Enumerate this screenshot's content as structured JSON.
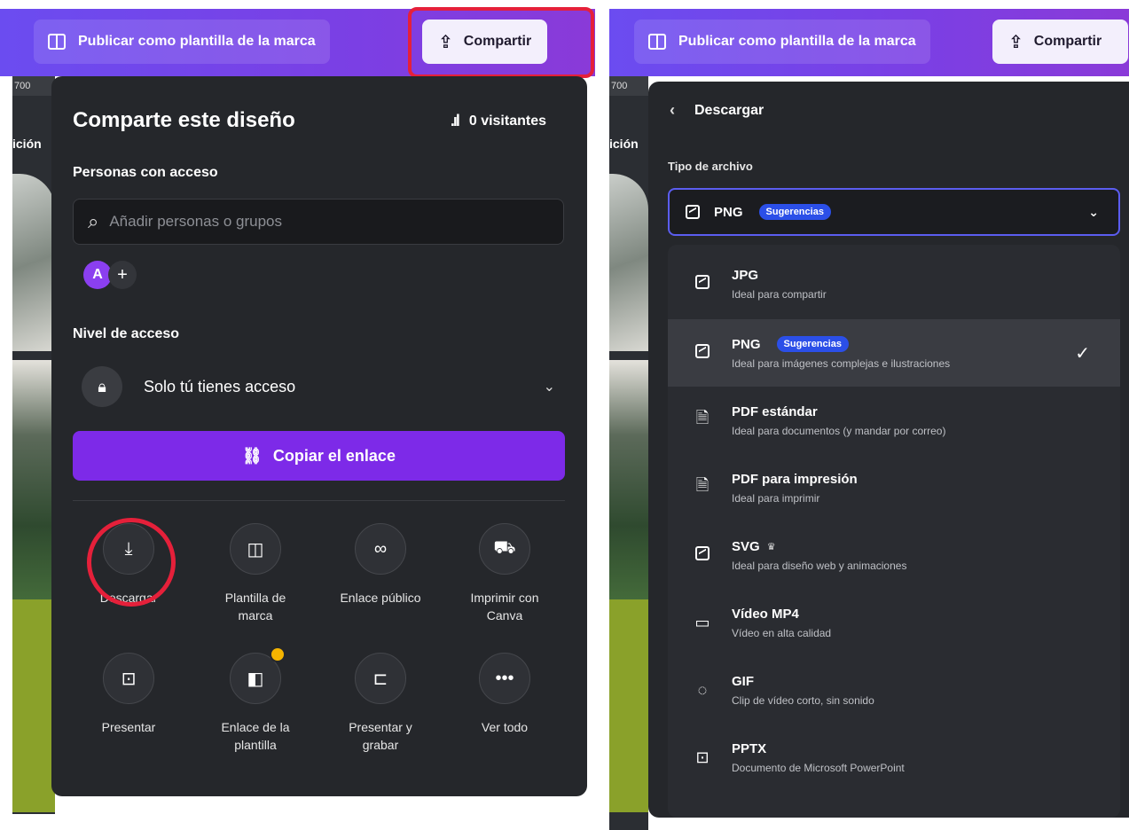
{
  "left": {
    "topbar": {
      "publish_label": "Publicar como plantilla de la marca",
      "share_label": "Compartir"
    },
    "canvas": {
      "ruler": "700",
      "label": "ición"
    },
    "share": {
      "title": "Comparte este diseño",
      "visitors": "0 visitantes",
      "people_label": "Personas con acceso",
      "search_placeholder": "Añadir personas o grupos",
      "avatar_initial": "A",
      "access_label": "Nivel de acceso",
      "access_value": "Solo tú tienes acceso",
      "copy_label": "Copiar el enlace",
      "actions": [
        {
          "label": "Descargar",
          "icon": "download-icon"
        },
        {
          "label": "Plantilla de marca",
          "icon": "brand-template-icon"
        },
        {
          "label": "Enlace público",
          "icon": "link-icon"
        },
        {
          "label": "Imprimir con Canva",
          "icon": "truck-icon"
        },
        {
          "label": "Presentar",
          "icon": "present-icon"
        },
        {
          "label": "Enlace de la plantilla",
          "icon": "template-link-icon"
        },
        {
          "label": "Presentar y grabar",
          "icon": "record-icon"
        },
        {
          "label": "Ver todo",
          "icon": "more-icon"
        }
      ]
    }
  },
  "right": {
    "topbar": {
      "publish_label": "Publicar como plantilla de la marca",
      "share_label": "Compartir"
    },
    "canvas": {
      "ruler": "700",
      "label": "ición"
    },
    "download": {
      "title": "Descargar",
      "file_type_label": "Tipo de archivo",
      "selected": "PNG",
      "selected_badge": "Sugerencias",
      "options": [
        {
          "name": "JPG",
          "desc": "Ideal para compartir",
          "icon": "image-icon",
          "badge": ""
        },
        {
          "name": "PNG",
          "desc": "Ideal para imágenes complejas e ilustraciones",
          "icon": "image-icon",
          "badge": "Sugerencias"
        },
        {
          "name": "PDF estándar",
          "desc": "Ideal para documentos (y mandar por correo)",
          "icon": "document-icon",
          "badge": ""
        },
        {
          "name": "PDF para impresión",
          "desc": "Ideal para imprimir",
          "icon": "document-icon",
          "badge": ""
        },
        {
          "name": "SVG",
          "desc": "Ideal para diseño web y animaciones",
          "icon": "image-icon",
          "badge": ""
        },
        {
          "name": "Vídeo MP4",
          "desc": "Vídeo en alta calidad",
          "icon": "video-icon",
          "badge": ""
        },
        {
          "name": "GIF",
          "desc": "Clip de vídeo corto, sin sonido",
          "icon": "gif-icon",
          "badge": ""
        },
        {
          "name": "PPTX",
          "desc": "Documento de Microsoft PowerPoint",
          "icon": "present-icon",
          "badge": ""
        }
      ]
    }
  },
  "colors": {
    "accent": "#7d2ae8",
    "highlight": "#e5203a",
    "panel": "#25272b",
    "badge": "#2b4fe8"
  }
}
